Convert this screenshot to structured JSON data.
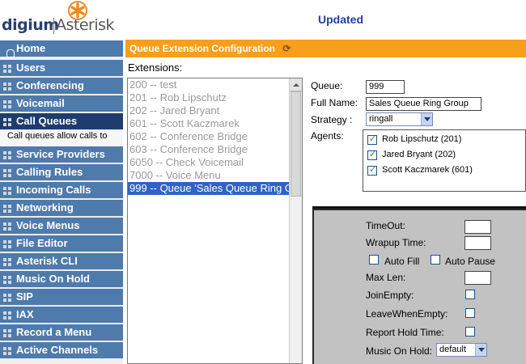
{
  "header": {
    "logo_digium": "digium",
    "logo_asterisk": "Asterisk",
    "status": "Updated"
  },
  "sidebar": {
    "items": [
      {
        "label": "Home",
        "icon": "home-icon"
      },
      {
        "label": "Users",
        "icon": "grid-icon"
      },
      {
        "label": "Conferencing",
        "icon": "grid-icon"
      },
      {
        "label": "Voicemail",
        "icon": "grid-icon"
      },
      {
        "label": "Call Queues",
        "icon": "grid-icon"
      },
      {
        "label": "Service Providers",
        "icon": "grid-icon"
      },
      {
        "label": "Calling Rules",
        "icon": "grid-icon"
      },
      {
        "label": "Incoming Calls",
        "icon": "grid-icon"
      },
      {
        "label": "Networking",
        "icon": "grid-icon"
      },
      {
        "label": "Voice Menus",
        "icon": "grid-icon"
      },
      {
        "label": "File Editor",
        "icon": "grid-icon"
      },
      {
        "label": "Asterisk CLI",
        "icon": "grid-icon"
      },
      {
        "label": "Music On Hold",
        "icon": "grid-icon"
      },
      {
        "label": "SIP",
        "icon": "grid-icon"
      },
      {
        "label": "IAX",
        "icon": "grid-icon"
      },
      {
        "label": "Record a Menu",
        "icon": "grid-icon"
      },
      {
        "label": "Active Channels",
        "icon": "grid-icon"
      }
    ],
    "active_description": "Call queues allow calls to"
  },
  "main": {
    "title": "Queue Extension Configuration",
    "extensions_label": "Extensions:",
    "extensions": [
      "200 -- test",
      "201 -- Rob Lipschutz",
      "202 -- Jared Bryant",
      "601 -- Scott Kaczmarek",
      "602 -- Conference Bridge",
      "603 -- Conference Bridge",
      "6050 -- Check Voicemail",
      "7000 -- Voice Menu",
      "999 -- Queue 'Sales Queue Ring G"
    ],
    "form": {
      "queue_label": "Queue:",
      "queue_value": "999",
      "fullname_label": "Full Name:",
      "fullname_value": "Sales Queue Ring Group",
      "strategy_label": "Strategy :",
      "strategy_value": "ringall",
      "agents_label": "Agents:",
      "agents": [
        {
          "label": "Rob Lipschutz (201)",
          "checked": true
        },
        {
          "label": "Jared Bryant (202)",
          "checked": true
        },
        {
          "label": "Scott Kaczmarek (601)",
          "checked": true
        }
      ]
    },
    "options": {
      "timeout_label": "TimeOut:",
      "timeout_value": "",
      "wrapup_label": "Wrapup Time:",
      "wrapup_value": "",
      "autofill_label": "Auto Fill",
      "autopause_label": "Auto Pause",
      "maxlen_label": "Max Len:",
      "maxlen_value": "",
      "joinempty_label": "JoinEmpty:",
      "leaveempty_label": "LeaveWhenEmpty:",
      "reportholdtime_label": "Report Hold Time:",
      "musiconhold_label": "Music On Hold:",
      "musiconhold_value": "default"
    }
  },
  "colors": {
    "nav_bg": "#4f7aac",
    "nav_active_bg": "#1e3c6e",
    "title_bar": "#f79e1b",
    "selection": "#3163c5",
    "updated_text": "#1f3f9f"
  }
}
